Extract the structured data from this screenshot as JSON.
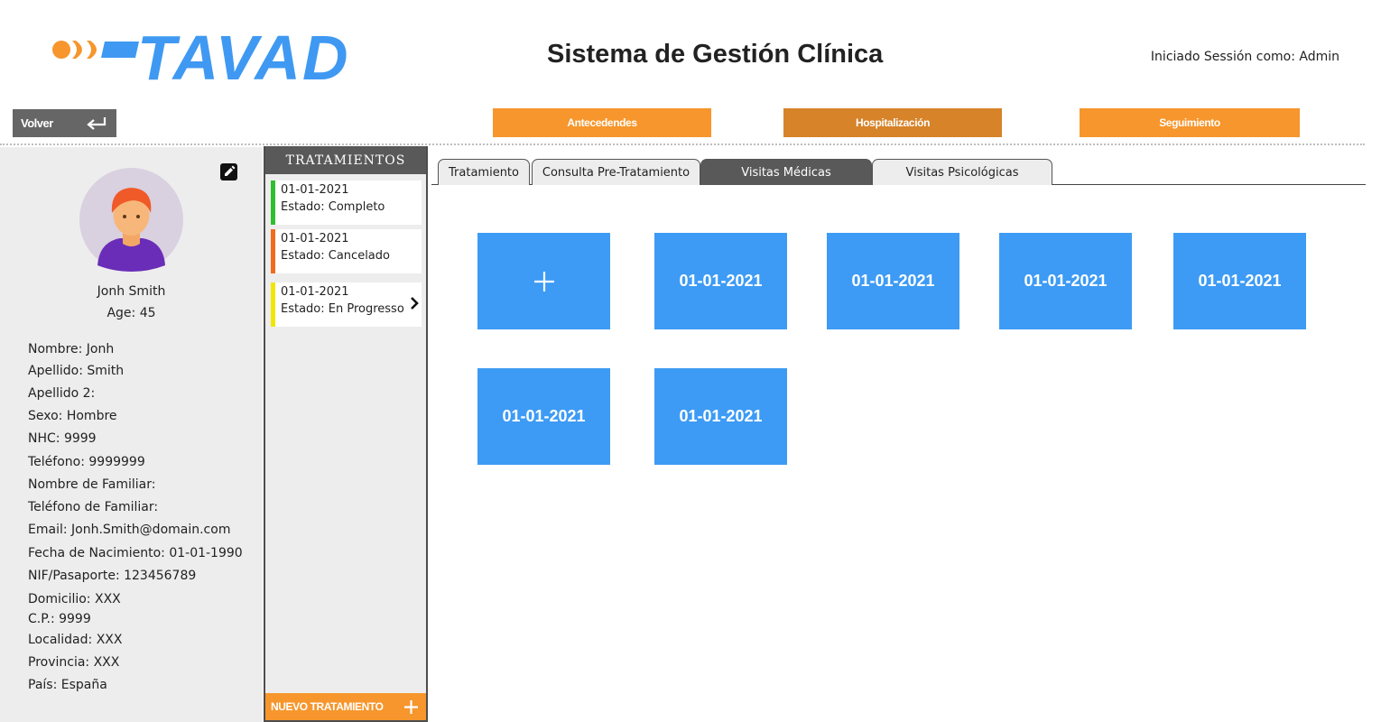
{
  "header": {
    "logo_text": "TAVAD",
    "app_title": "Sistema de Gestión Clínica",
    "session": "Iniciado Sessión como: Admin"
  },
  "nav": {
    "back_label": "Volver",
    "buttons": [
      {
        "label": "Antecedendes",
        "active": false
      },
      {
        "label": "Hospitalización",
        "active": true
      },
      {
        "label": "Seguimiento",
        "active": false
      }
    ]
  },
  "patient": {
    "name": "Jonh Smith",
    "age": "Age: 45",
    "fields": [
      "Nombre: Jonh",
      "Apellido: Smith",
      "Apellido 2:",
      "Sexo: Hombre",
      "NHC: 9999",
      "Teléfono: 9999999",
      "Nombre de Familiar:",
      "Teléfono de Familiar:",
      "Email: Jonh.Smith@domain.com",
      "Fecha de Nacimiento: 01-01-1990",
      "NIF/Pasaporte: 123456789",
      "Domicilio: XXX",
      "C.P.: 9999",
      "Localidad: XXX",
      "Provincia: XXX",
      "País: España"
    ]
  },
  "treatments": {
    "title": "TRATAMIENTOS",
    "items": [
      {
        "date": "01-01-2021",
        "status": "Estado: Completo",
        "color": "#2fbf2f"
      },
      {
        "date": "01-01-2021",
        "status": "Estado: Cancelado",
        "color": "#f26b1d"
      },
      {
        "date": "01-01-2021",
        "status": "Estado: En Progresso",
        "color": "#f2e600"
      }
    ],
    "new_label": "NUEVO TRATAMIENTO"
  },
  "tabs": [
    {
      "label": "Tratamiento",
      "active": false
    },
    {
      "label": "Consulta Pre-Tratamiento",
      "active": false
    },
    {
      "label": "Visitas Médicas",
      "active": true
    },
    {
      "label": "Visitas Psicológicas",
      "active": false
    }
  ],
  "visits": [
    "01-01-2021",
    "01-01-2021",
    "01-01-2021",
    "01-01-2021",
    "01-01-2021",
    "01-01-2021"
  ],
  "colors": {
    "brand_blue": "#3f99f2",
    "tile_blue": "#3d9bf5",
    "accent_orange": "#f6962c",
    "active_orange": "#d6832a",
    "panel_gray": "#ededed",
    "dark_gray": "#595959"
  }
}
